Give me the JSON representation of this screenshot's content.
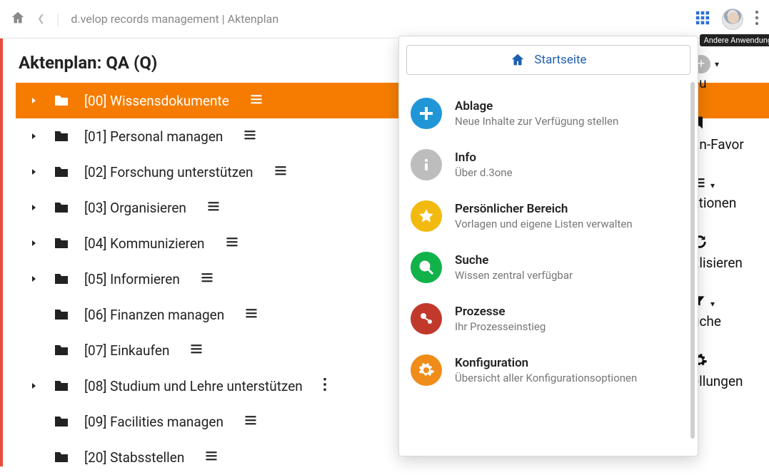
{
  "header": {
    "breadcrumb": "d.velop records management | Aktenplan",
    "tooltip_other_apps": "Andere Anwendungen"
  },
  "page_title": "Aktenplan: QA (Q)",
  "tree": [
    {
      "label": "[00] Wissensdokumente",
      "expandable": true,
      "active": true,
      "menu": "hamburger"
    },
    {
      "label": "[01] Personal managen",
      "expandable": true,
      "active": false,
      "menu": "hamburger"
    },
    {
      "label": "[02] Forschung unterstützen",
      "expandable": true,
      "active": false,
      "menu": "hamburger"
    },
    {
      "label": "[03] Organisieren",
      "expandable": true,
      "active": false,
      "menu": "hamburger"
    },
    {
      "label": "[04] Kommunizieren",
      "expandable": true,
      "active": false,
      "menu": "hamburger"
    },
    {
      "label": "[05] Informieren",
      "expandable": true,
      "active": false,
      "menu": "hamburger"
    },
    {
      "label": "[06] Finanzen managen",
      "expandable": false,
      "active": false,
      "menu": "hamburger"
    },
    {
      "label": "[07] Einkaufen",
      "expandable": false,
      "active": false,
      "menu": "hamburger"
    },
    {
      "label": "[08] Studium und Lehre unterstützen",
      "expandable": true,
      "active": false,
      "menu": "dots"
    },
    {
      "label": "[09] Facilities managen",
      "expandable": false,
      "active": false,
      "menu": "hamburger"
    },
    {
      "label": "[20] Stabsstellen",
      "expandable": false,
      "active": false,
      "menu": "hamburger"
    }
  ],
  "drawer": {
    "home_label": "Startseite",
    "tiles": [
      {
        "title": "Ablage",
        "subtitle": "Neue Inhalte zur Verfügung stellen",
        "color": "c-blue",
        "icon": "plus"
      },
      {
        "title": "Info",
        "subtitle": "Über d.3one",
        "color": "c-grey",
        "icon": "info"
      },
      {
        "title": "Persönlicher Bereich",
        "subtitle": "Vorlagen und eigene Listen verwalten",
        "color": "c-yellow",
        "icon": "star"
      },
      {
        "title": "Suche",
        "subtitle": "Wissen zentral verfügbar",
        "color": "c-green",
        "icon": "search"
      },
      {
        "title": "Prozesse",
        "subtitle": "Ihr Prozesseinstieg",
        "color": "c-red",
        "icon": "process"
      },
      {
        "title": "Konfiguration",
        "subtitle": "Übersicht aller Konfigurationsoptionen",
        "color": "c-orange",
        "icon": "gear"
      }
    ]
  },
  "rightpanel": {
    "items": [
      {
        "label": "eu",
        "icon": "plus-circle",
        "chev": true
      },
      {
        "label": "an-Favor",
        "icon": "bookmark",
        "chev": false
      },
      {
        "label": "ktionen",
        "icon": "hamburger",
        "chev": true
      },
      {
        "label": "alisieren",
        "icon": "refresh",
        "chev": false
      },
      {
        "label": "uche",
        "icon": "funnel",
        "chev": true
      },
      {
        "label": "ellungen",
        "icon": "gear",
        "chev": false
      }
    ]
  }
}
